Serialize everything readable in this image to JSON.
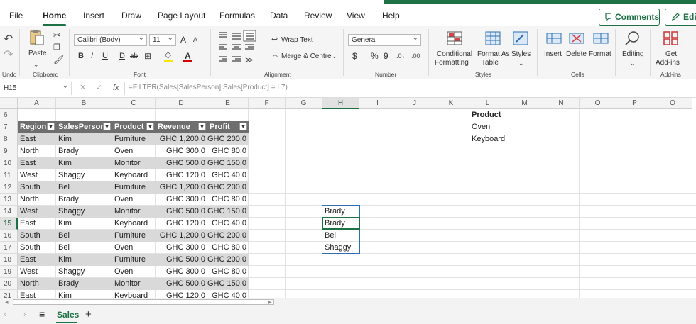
{
  "menu": {
    "items": [
      "File",
      "Home",
      "Insert",
      "Draw",
      "Page Layout",
      "Formulas",
      "Data",
      "Review",
      "View",
      "Help"
    ],
    "active": "Home",
    "comments_label": "Comments",
    "edit_label": "Edit"
  },
  "ribbon": {
    "undo_label": "Undo",
    "clipboard": {
      "paste_label": "Paste",
      "group_label": "Clipboard"
    },
    "font": {
      "family": "Calibri (Body)",
      "size": "11",
      "grow": "A",
      "shrink": "A",
      "bold": "B",
      "italic": "I",
      "underline": "U",
      "double_underline": "D",
      "strike": "ab",
      "group_label": "Font"
    },
    "alignment": {
      "wrap_label": "Wrap Text",
      "merge_label": "Merge & Centre",
      "group_label": "Alignment"
    },
    "number": {
      "format": "General",
      "currency": "$",
      "percent": "%",
      "comma": "9",
      "group_label": "Number"
    },
    "styles": {
      "conditional_1": "Conditional",
      "conditional_2": "Formatting",
      "format_table_1": "Format As",
      "format_table_2": "Table",
      "styles_label": "Styles",
      "group_label": "Styles"
    },
    "cells": {
      "insert_label": "Insert",
      "delete_label": "Delete",
      "format_label": "Format",
      "group_label": "Cells"
    },
    "editing": {
      "label": "Editing"
    },
    "addins": {
      "get_1": "Get",
      "get_2": "Add-ins",
      "group_label": "Add-ins"
    }
  },
  "formula_bar": {
    "name_box": "H15",
    "fx": "fx",
    "formula": "=FILTER(Sales[SalesPerson],Sales[Product] = L7)"
  },
  "grid": {
    "columns": [
      "A",
      "B",
      "C",
      "D",
      "E",
      "F",
      "G",
      "H",
      "I",
      "J",
      "K",
      "L",
      "M",
      "N",
      "O",
      "P",
      "Q"
    ],
    "selected_column": "H",
    "rows": [
      "6",
      "7",
      "8",
      "9",
      "10",
      "11",
      "12",
      "13",
      "14",
      "15",
      "16",
      "17",
      "18",
      "19",
      "20",
      "21"
    ],
    "selected_row": "15",
    "table_headers": [
      "Region",
      "SalesPerson",
      "Product",
      "Revenue",
      "Profit"
    ],
    "table_rows": [
      [
        "East",
        "Kim",
        "Furniture",
        "GHC 1,200.0",
        "GHC 200.0"
      ],
      [
        "North",
        "Brady",
        "Oven",
        "GHC 300.0",
        "GHC 80.0"
      ],
      [
        "East",
        "Kim",
        "Monitor",
        "GHC 500.0",
        "GHC 150.0"
      ],
      [
        "West",
        "Shaggy",
        "Keyboard",
        "GHC 120.0",
        "GHC 40.0"
      ],
      [
        "South",
        "Bel",
        "Furniture",
        "GHC 1,200.0",
        "GHC 200.0"
      ],
      [
        "North",
        "Brady",
        "Oven",
        "GHC 300.0",
        "GHC 80.0"
      ],
      [
        "West",
        "Shaggy",
        "Monitor",
        "GHC 500.0",
        "GHC 150.0"
      ],
      [
        "East",
        "Kim",
        "Keyboard",
        "GHC 120.0",
        "GHC 40.0"
      ],
      [
        "South",
        "Bel",
        "Furniture",
        "GHC 1,200.0",
        "GHC 200.0"
      ],
      [
        "South",
        "Bel",
        "Oven",
        "GHC 300.0",
        "GHC 80.0"
      ],
      [
        "East",
        "Kim",
        "Furniture",
        "GHC 500.0",
        "GHC 200.0"
      ],
      [
        "West",
        "Shaggy",
        "Oven",
        "GHC 300.0",
        "GHC 80.0"
      ],
      [
        "North",
        "Brady",
        "Monitor",
        "GHC 500.0",
        "GHC 150.0"
      ],
      [
        "East",
        "Kim",
        "Keyboard",
        "GHC 120.0",
        "GHC 40.0"
      ]
    ],
    "product_header": "Product",
    "product_values": [
      "Oven",
      "Keyboard"
    ],
    "filter_results": [
      "Brady",
      "Brady",
      "Bel",
      "Shaggy"
    ]
  },
  "sheets": {
    "tabs": [
      "Sales"
    ],
    "active": "Sales",
    "add_label": "+"
  },
  "colors": {
    "accent": "#1e7145",
    "table_header": "#6e6e6e",
    "band": "#d9d9d9",
    "spill_border": "#2f6fb0"
  }
}
